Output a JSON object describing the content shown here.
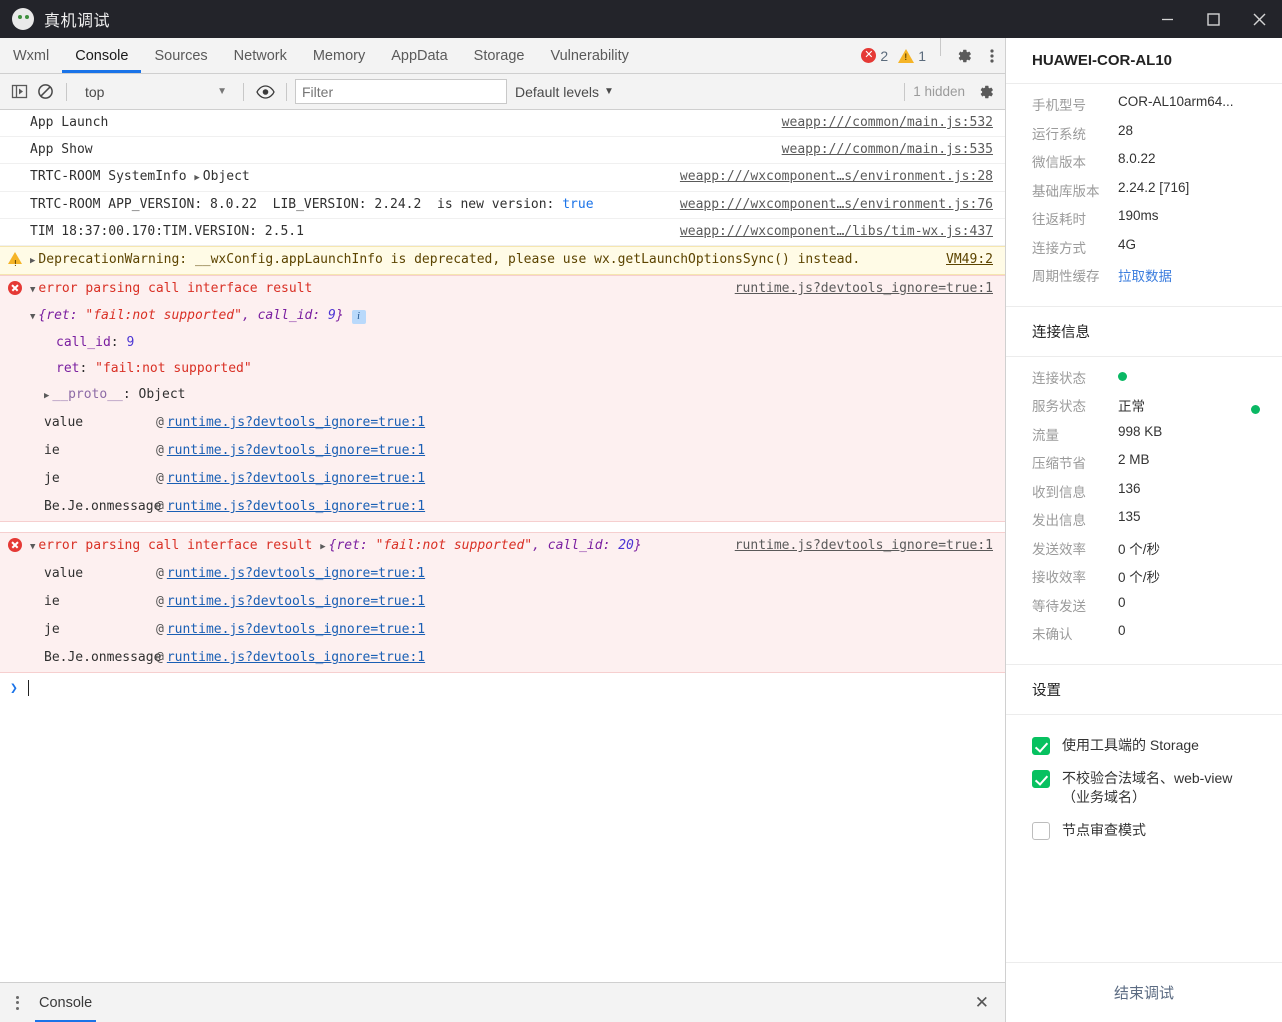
{
  "window": {
    "title": "真机调试",
    "app_icon": "wechat-logo-icon",
    "minimize_label": "最小化",
    "maximize_label": "最大化",
    "close_label": "关闭"
  },
  "tabs": [
    {
      "label": "Wxml",
      "active": false
    },
    {
      "label": "Console",
      "active": true
    },
    {
      "label": "Sources",
      "active": false
    },
    {
      "label": "Network",
      "active": false
    },
    {
      "label": "Memory",
      "active": false
    },
    {
      "label": "AppData",
      "active": false
    },
    {
      "label": "Storage",
      "active": false
    },
    {
      "label": "Vulnerability",
      "active": false
    }
  ],
  "status_counts": {
    "errors": "2",
    "warnings": "1"
  },
  "tabstrip_icons": {
    "settings": "gear-icon",
    "more": "kebab-menu-icon"
  },
  "console_toolbar": {
    "execute_label": "sidebar-toggle-icon",
    "clear_label": "clear-console-icon",
    "context": "top",
    "context_caret": "▼",
    "eye": "eye-icon",
    "filter_placeholder": "Filter",
    "filter_value": "",
    "levels": "Default levels",
    "levels_caret": "▼",
    "hidden": "1 hidden",
    "settings": "gear-icon"
  },
  "console_rows": [
    {
      "kind": "log",
      "message": "App Launch",
      "source": "weapp:///common/main.js:532"
    },
    {
      "kind": "log",
      "message": "App Show",
      "source": "weapp:///common/main.js:535"
    },
    {
      "kind": "log_object",
      "prefix": "TRTC-ROOM SystemInfo ",
      "arrow": "▶",
      "object_label": "Object",
      "source": "weapp:///wxcomponent…s/environment.js:28"
    },
    {
      "kind": "log_bool",
      "prefix": "TRTC-ROOM APP_VERSION: 8.0.22  LIB_VERSION: 2.24.2  is new version: ",
      "bool": "true",
      "source": "weapp:///wxcomponent…s/environment.js:76"
    },
    {
      "kind": "log",
      "message": "TIM 18:37:00.170:TIM.VERSION: 2.5.1",
      "source": "weapp:///wxcomponent…/libs/tim-wx.js:437"
    },
    {
      "kind": "warning",
      "arrow": "▶",
      "message": "DeprecationWarning: __wxConfig.appLaunchInfo is deprecated, please use wx.getLaunchOptionsSync() instead.",
      "source": "VM49:2"
    }
  ],
  "error_block_1": {
    "arrow": "▼",
    "title": "error parsing call interface result",
    "source": "runtime.js?devtools_ignore=true:1",
    "object_arrow": "▼",
    "object_preview": {
      "open": "{",
      "key1": "ret",
      "sep1": ": ",
      "val1": "\"fail:not supported\"",
      "comma": ", ",
      "key2": "call_id",
      "sep2": ": ",
      "val2": "9",
      "close": "}"
    },
    "info_badge": "i",
    "props": [
      {
        "arrow": "",
        "key": "call_id",
        "sep": ": ",
        "value": "9",
        "type": "num"
      },
      {
        "arrow": "",
        "key": "ret",
        "sep": ": ",
        "value": "\"fail:not supported\"",
        "type": "str"
      },
      {
        "arrow": "▶",
        "key": "__proto__",
        "sep": ": ",
        "value": "Object",
        "type": "plain"
      }
    ],
    "stack": [
      {
        "fn": "value",
        "at": "@",
        "link": "runtime.js?devtools_ignore=true:1"
      },
      {
        "fn": "ie",
        "at": "@",
        "link": "runtime.js?devtools_ignore=true:1"
      },
      {
        "fn": "je",
        "at": "@",
        "link": "runtime.js?devtools_ignore=true:1"
      },
      {
        "fn": "Be.Je.onmessage",
        "at": "@",
        "link": "runtime.js?devtools_ignore=true:1"
      }
    ]
  },
  "error_block_2": {
    "arrow": "▼",
    "title": "error parsing call interface result",
    "inline_arrow": "▶",
    "source": "runtime.js?devtools_ignore=true:1",
    "object_preview": {
      "open": "{",
      "key1": "ret",
      "sep1": ": ",
      "val1": "\"fail:not supported\"",
      "comma": ", ",
      "key2": "call_id",
      "sep2": ": ",
      "val2": "20",
      "close": "}"
    },
    "stack": [
      {
        "fn": "value",
        "at": "@",
        "link": "runtime.js?devtools_ignore=true:1"
      },
      {
        "fn": "ie",
        "at": "@",
        "link": "runtime.js?devtools_ignore=true:1"
      },
      {
        "fn": "je",
        "at": "@",
        "link": "runtime.js?devtools_ignore=true:1"
      },
      {
        "fn": "Be.Je.onmessage",
        "at": "@",
        "link": "runtime.js?devtools_ignore=true:1"
      }
    ]
  },
  "prompt": {
    "chevron": "❯",
    "value": ""
  },
  "drawer": {
    "menu_icon": "kebab-menu-icon",
    "tab": "Console",
    "close": "✕"
  },
  "sidebar": {
    "device_title": "HUAWEI-COR-AL10",
    "device_info": [
      {
        "key": "手机型号",
        "value": "COR-AL10arm64...",
        "style": "text"
      },
      {
        "key": "运行系统",
        "value": "28",
        "style": "text"
      },
      {
        "key": "微信版本",
        "value": "8.0.22",
        "style": "text"
      },
      {
        "key": "基础库版本",
        "value": "2.24.2 [716]",
        "style": "text"
      },
      {
        "key": "往返耗时",
        "value": "190ms",
        "style": "text"
      },
      {
        "key": "连接方式",
        "value": "4G",
        "style": "text"
      },
      {
        "key": "周期性缓存",
        "value": "拉取数据",
        "style": "link"
      }
    ],
    "connection_title": "连接信息",
    "connection_info": [
      {
        "key": "连接状态",
        "value": "",
        "style": "dot"
      },
      {
        "key": "服务状态",
        "value": "正常",
        "style": "text-with-dot"
      },
      {
        "key": "流量",
        "value": "998 KB",
        "style": "text"
      },
      {
        "key": "压缩节省",
        "value": "2 MB",
        "style": "text"
      },
      {
        "key": "收到信息",
        "value": "136",
        "style": "text"
      },
      {
        "key": "发出信息",
        "value": "135",
        "style": "text"
      },
      {
        "key": "发送效率",
        "value": "0 个/秒",
        "style": "text"
      },
      {
        "key": "接收效率",
        "value": "0 个/秒",
        "style": "text"
      },
      {
        "key": "等待发送",
        "value": "0",
        "style": "text"
      },
      {
        "key": "未确认",
        "value": "0",
        "style": "text"
      }
    ],
    "settings_title": "设置",
    "settings": [
      {
        "label": "使用工具端的 Storage",
        "checked": true
      },
      {
        "label": "不校验合法域名、web-view（业务域名）",
        "checked": true
      },
      {
        "label": "节点审查模式",
        "checked": false
      }
    ],
    "end_debug_label": "结束调试"
  },
  "colors": {
    "accent_blue": "#1a73e8",
    "error_red": "#e53935",
    "warn_yellow": "#f5b427",
    "status_green": "#0ab864",
    "checkbox_green": "#07c160",
    "titlebar_bg": "#23242a"
  }
}
